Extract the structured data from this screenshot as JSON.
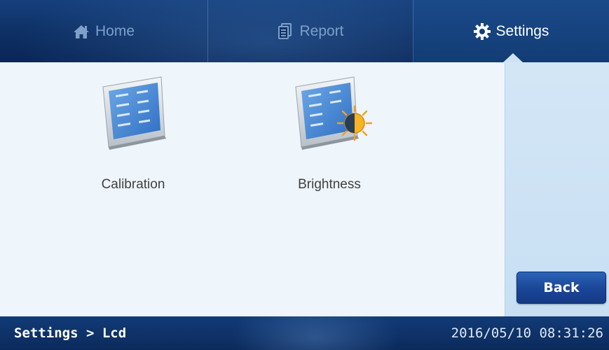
{
  "nav": {
    "tabs": [
      {
        "label": "Home",
        "icon": "home-icon"
      },
      {
        "label": "Report",
        "icon": "report-icon"
      },
      {
        "label": "Settings",
        "icon": "gear-icon",
        "active": true
      }
    ]
  },
  "main": {
    "items": [
      {
        "label": "Calibration",
        "icon": "lcd-calibration-icon"
      },
      {
        "label": "Brightness",
        "icon": "lcd-brightness-icon"
      }
    ]
  },
  "actions": {
    "back_label": "Back"
  },
  "status": {
    "breadcrumb": "Settings > Lcd",
    "datetime": "2016/05/10 08:31:26"
  },
  "colors": {
    "nav_bg": "#0d2f63",
    "active_tab_text": "#ffffff",
    "inactive_tab_text": "#7e9fc9",
    "main_bg": "#eef5fb",
    "side_panel_bg": "#cfe2f4",
    "button_bg": "#1a4596"
  }
}
